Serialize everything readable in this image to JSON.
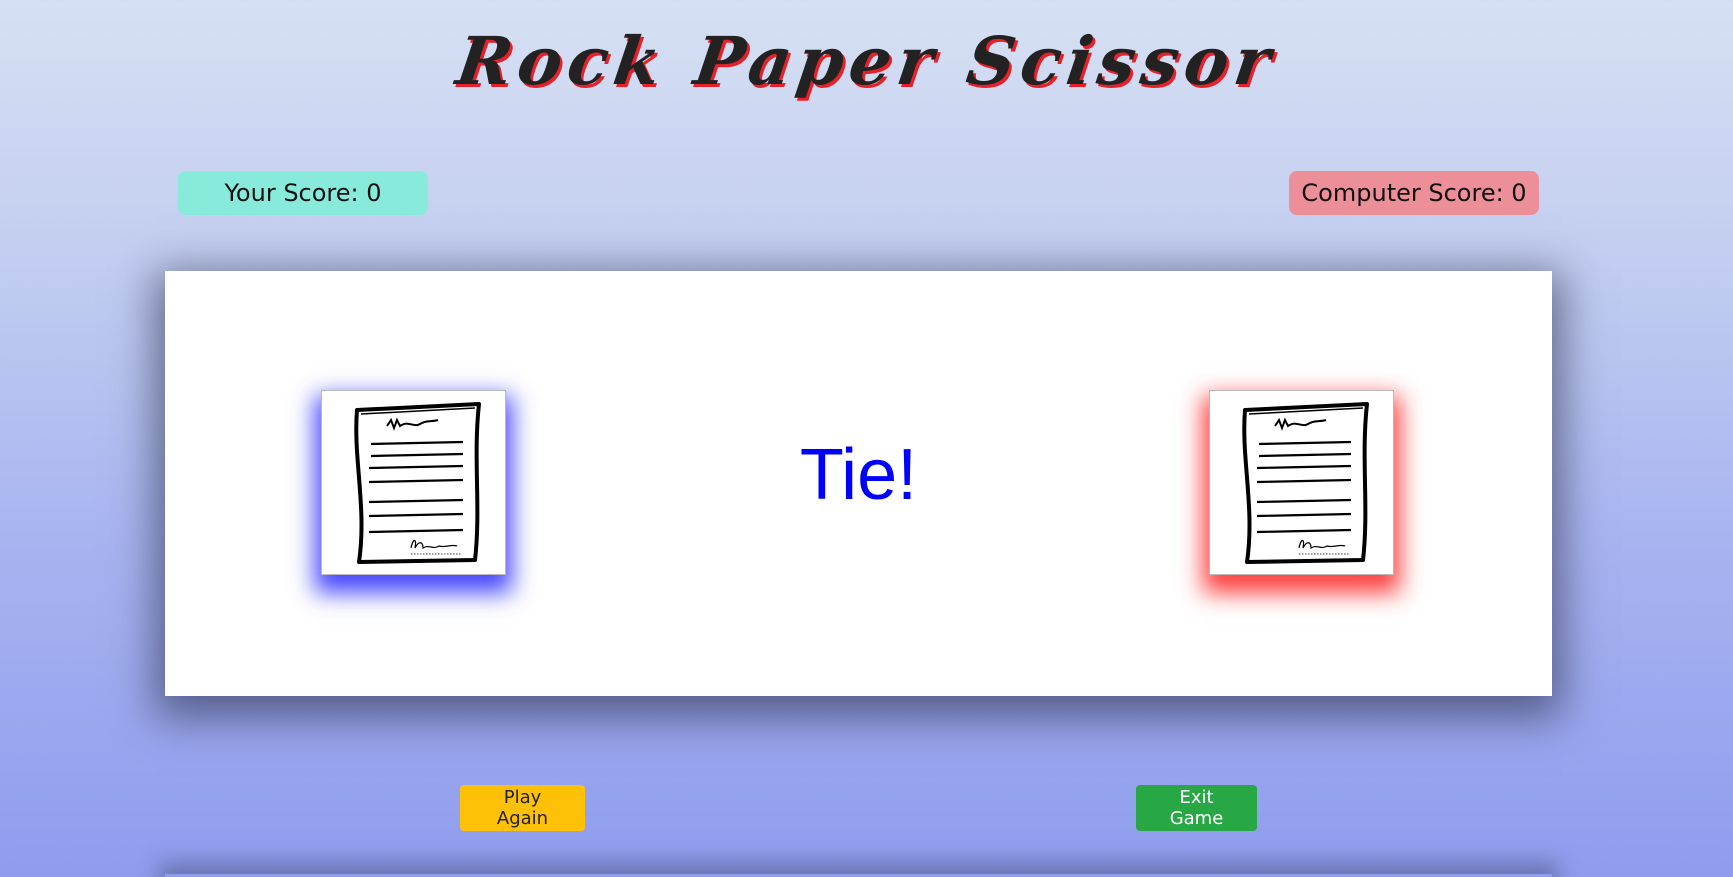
{
  "game": {
    "title": "Rock Paper Scissor",
    "player_score_label": "Your Score: 0",
    "computer_score_label": "Computer Score: 0",
    "player_score": 0,
    "computer_score": 0,
    "result_text": "Tie!",
    "player_choice": "paper",
    "computer_choice": "paper"
  },
  "buttons": {
    "play_again": "Play Again",
    "exit_game": "Exit Game"
  },
  "colors": {
    "player_glow": "#2828ff",
    "computer_glow": "#ff1e1e",
    "result": "#0000ff",
    "player_score_bg": "#88eadb",
    "computer_score_bg": "#ec8f99",
    "play_again_bg": "#ffc107",
    "exit_game_bg": "#28a745"
  },
  "icons": {
    "player_choice": "paper-document-icon",
    "computer_choice": "paper-document-icon"
  }
}
